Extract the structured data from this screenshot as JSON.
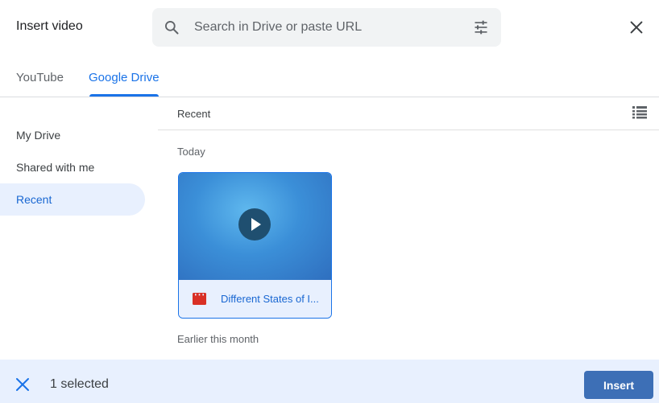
{
  "dialog": {
    "title": "Insert video",
    "close_icon": "close-icon"
  },
  "search": {
    "placeholder": "Search in Drive or paste URL",
    "value": "",
    "search_icon": "search-icon",
    "filter_icon": "tune-icon"
  },
  "tabs": [
    {
      "label": "YouTube",
      "active": false
    },
    {
      "label": "Google Drive",
      "active": true
    }
  ],
  "sidebar": {
    "items": [
      {
        "label": "My Drive",
        "active": false
      },
      {
        "label": "Shared with me",
        "active": false
      },
      {
        "label": "Recent",
        "active": true
      }
    ]
  },
  "main": {
    "breadcrumb": "Recent",
    "view_icon": "list-view-icon",
    "sections": [
      {
        "label": "Today"
      },
      {
        "label": "Earlier this month"
      }
    ],
    "files": [
      {
        "name": "Different States of I...",
        "type_icon": "video-file-icon",
        "selected": true
      }
    ]
  },
  "footer": {
    "selected_text": "1 selected",
    "insert_label": "Insert",
    "clear_icon": "close-icon"
  },
  "colors": {
    "accent": "#1a73e8",
    "selected_bg": "#e8f0fe",
    "insert_button": "#3d6fb6",
    "video_icon": "#d93025"
  }
}
